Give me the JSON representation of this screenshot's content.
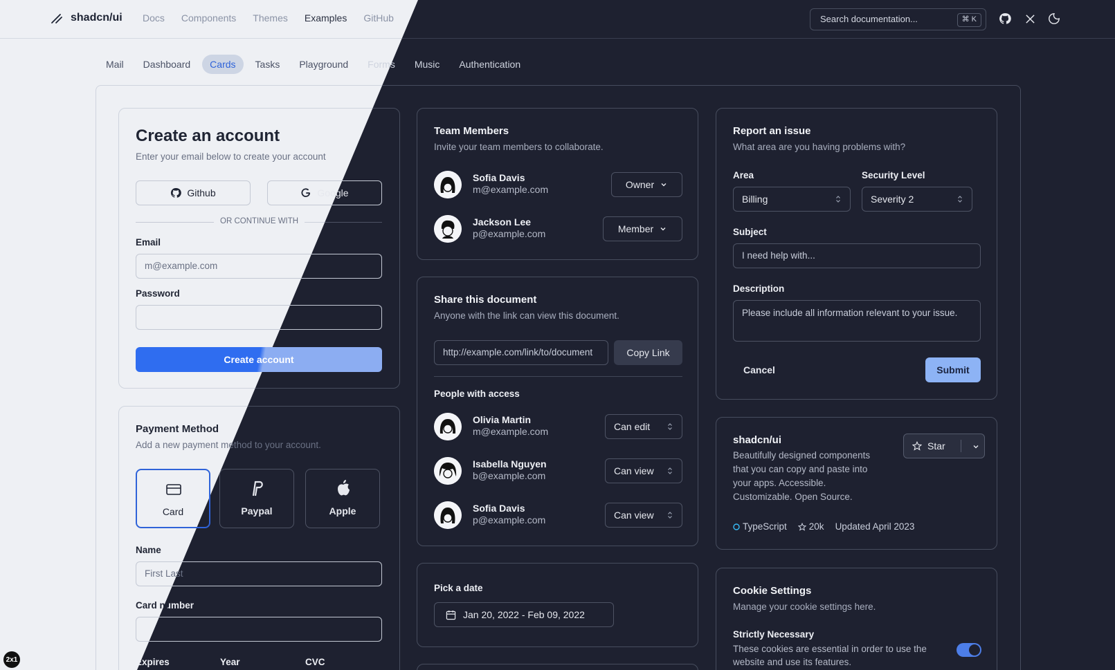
{
  "header": {
    "logo": "shadcn/ui",
    "nav": [
      "Docs",
      "Components",
      "Themes",
      "Examples",
      "GitHub"
    ],
    "search_placeholder": "Search documentation...",
    "search_kbd": "⌘ K"
  },
  "tabs": [
    "Mail",
    "Dashboard",
    "Cards",
    "Tasks",
    "Playground",
    "Forms",
    "Music",
    "Authentication"
  ],
  "create_account": {
    "title": "Create an account",
    "description": "Enter your email below to create your account",
    "github": "Github",
    "google": "Google",
    "divider": "OR CONTINUE WITH",
    "email_label": "Email",
    "email_placeholder": "m@example.com",
    "password_label": "Password",
    "submit": "Create account"
  },
  "payment": {
    "title": "Payment Method",
    "description": "Add a new payment method to your account.",
    "methods": [
      "Card",
      "Paypal",
      "Apple"
    ],
    "name_label": "Name",
    "name_placeholder": "First Last",
    "card_number_label": "Card number",
    "expires_label": "Expires",
    "year_label": "Year",
    "cvc_label": "CVC"
  },
  "team": {
    "title": "Team Members",
    "description": "Invite your team members to collaborate.",
    "members": [
      {
        "name": "Sofia Davis",
        "email": "m@example.com",
        "role": "Owner"
      },
      {
        "name": "Jackson Lee",
        "email": "p@example.com",
        "role": "Member"
      }
    ]
  },
  "share": {
    "title": "Share this document",
    "description": "Anyone with the link can view this document.",
    "link": "http://example.com/link/to/document",
    "copy": "Copy Link",
    "people_title": "People with access",
    "people": [
      {
        "name": "Olivia Martin",
        "email": "m@example.com",
        "perm": "Can edit"
      },
      {
        "name": "Isabella Nguyen",
        "email": "b@example.com",
        "perm": "Can view"
      },
      {
        "name": "Sofia Davis",
        "email": "p@example.com",
        "perm": "Can view"
      }
    ]
  },
  "date": {
    "label": "Pick a date",
    "range": "Jan 20, 2022 - Feb 09, 2022"
  },
  "report": {
    "title": "Report an issue",
    "description": "What area are you having problems with?",
    "area_label": "Area",
    "area_value": "Billing",
    "security_label": "Security Level",
    "security_value": "Severity 2",
    "subject_label": "Subject",
    "subject_placeholder": "I need help with...",
    "description_label": "Description",
    "description_placeholder": "Please include all information relevant to your issue.",
    "cancel": "Cancel",
    "submit": "Submit"
  },
  "repo": {
    "title": "shadcn/ui",
    "description": "Beautifully designed components that you can copy and paste into your apps. Accessible. Customizable. Open Source.",
    "star": "Star",
    "language": "TypeScript",
    "stars": "20k",
    "updated": "Updated April 2023"
  },
  "cookies": {
    "title": "Cookie Settings",
    "description": "Manage your cookie settings here.",
    "necessary_title": "Strictly Necessary",
    "necessary_desc": "These cookies are essential in order to use the website and use its features.",
    "necessary_on": true
  },
  "badge": "2x1"
}
